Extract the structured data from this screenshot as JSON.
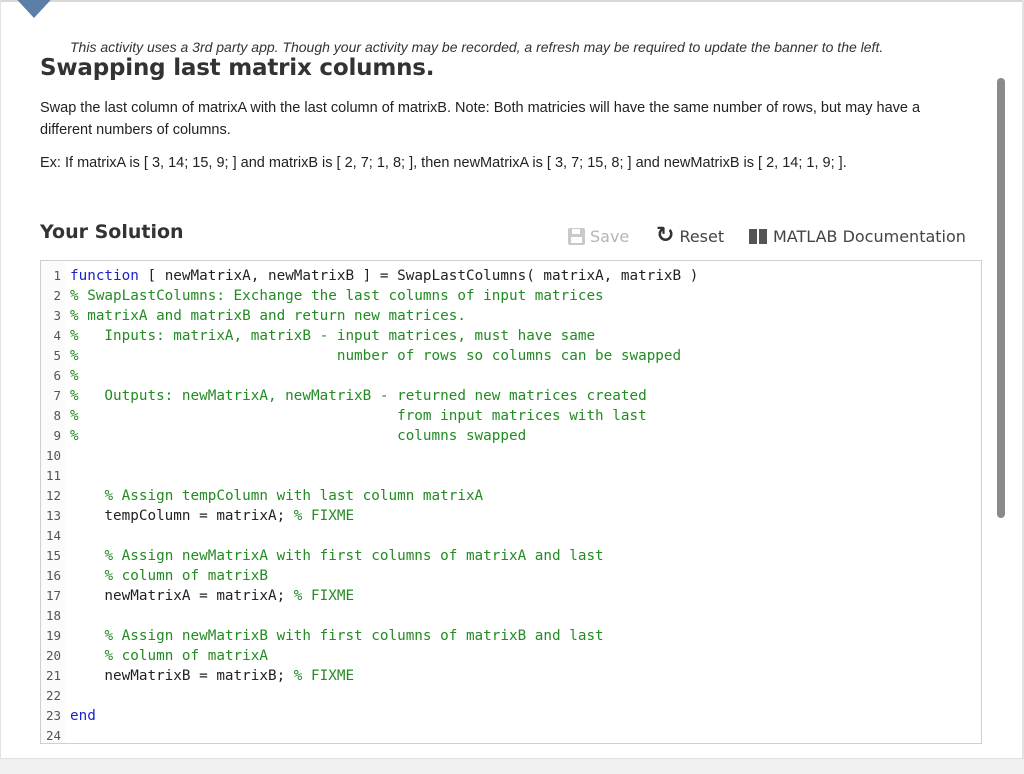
{
  "notice": "This activity uses a 3rd party app. Though your activity may be recorded, a refresh may be required to update the banner to the left.",
  "title": "Swapping last matrix columns.",
  "description": "Swap the last column of matrixA with the last column of matrixB. Note: Both matricies will have the same number of rows, but may have a different numbers of columns.",
  "example": "Ex: If matrixA is [ 3, 14; 15, 9; ] and matrixB is [ 2, 7; 1, 8; ], then newMatrixA is [ 3, 7; 15, 8; ] and newMatrixB is [ 2, 14; 1, 9; ].",
  "solution": {
    "title": "Your Solution",
    "save_label": "Save",
    "reset_label": "Reset",
    "doc_label": "MATLAB Documentation"
  },
  "icons": {
    "save": "save-icon",
    "reset": "reset-icon",
    "documentation": "book-icon"
  },
  "colors": {
    "keyword": "#1d22c8",
    "comment": "#228b22",
    "banner": "#5b7fa6"
  },
  "code_lines": [
    {
      "n": "1",
      "parts": [
        {
          "t": "function",
          "c": "kw"
        },
        {
          "t": " [ newMatrixA, newMatrixB ] = SwapLastColumns( matrixA, matrixB )",
          "c": ""
        }
      ]
    },
    {
      "n": "2",
      "parts": [
        {
          "t": "% SwapLastColumns: Exchange the last columns of input matrices",
          "c": "cm"
        }
      ]
    },
    {
      "n": "3",
      "parts": [
        {
          "t": "% matrixA and matrixB and return new matrices.",
          "c": "cm"
        }
      ]
    },
    {
      "n": "4",
      "parts": [
        {
          "t": "%   Inputs: matrixA, matrixB - input matrices, must have same",
          "c": "cm"
        }
      ]
    },
    {
      "n": "5",
      "parts": [
        {
          "t": "%                              number of rows so columns can be swapped",
          "c": "cm"
        }
      ]
    },
    {
      "n": "6",
      "parts": [
        {
          "t": "%",
          "c": "cm"
        }
      ]
    },
    {
      "n": "7",
      "parts": [
        {
          "t": "%   Outputs: newMatrixA, newMatrixB - returned new matrices created",
          "c": "cm"
        }
      ]
    },
    {
      "n": "8",
      "parts": [
        {
          "t": "%                                     from input matrices with last",
          "c": "cm"
        }
      ]
    },
    {
      "n": "9",
      "parts": [
        {
          "t": "%                                     columns swapped",
          "c": "cm"
        }
      ]
    },
    {
      "n": "10",
      "parts": []
    },
    {
      "n": "11",
      "parts": []
    },
    {
      "n": "12",
      "parts": [
        {
          "t": "    ",
          "c": ""
        },
        {
          "t": "% Assign tempColumn with last column matrixA",
          "c": "cm"
        }
      ]
    },
    {
      "n": "13",
      "parts": [
        {
          "t": "    tempColumn = matrixA; ",
          "c": ""
        },
        {
          "t": "% FIXME",
          "c": "cm"
        }
      ]
    },
    {
      "n": "14",
      "parts": []
    },
    {
      "n": "15",
      "parts": [
        {
          "t": "    ",
          "c": ""
        },
        {
          "t": "% Assign newMatrixA with first columns of matrixA and last",
          "c": "cm"
        }
      ]
    },
    {
      "n": "16",
      "parts": [
        {
          "t": "    ",
          "c": ""
        },
        {
          "t": "% column of matrixB",
          "c": "cm"
        }
      ]
    },
    {
      "n": "17",
      "parts": [
        {
          "t": "    newMatrixA = matrixA; ",
          "c": ""
        },
        {
          "t": "% FIXME",
          "c": "cm"
        }
      ]
    },
    {
      "n": "18",
      "parts": []
    },
    {
      "n": "19",
      "parts": [
        {
          "t": "    ",
          "c": ""
        },
        {
          "t": "% Assign newMatrixB with first columns of matrixB and last",
          "c": "cm"
        }
      ]
    },
    {
      "n": "20",
      "parts": [
        {
          "t": "    ",
          "c": ""
        },
        {
          "t": "% column of matrixA",
          "c": "cm"
        }
      ]
    },
    {
      "n": "21",
      "parts": [
        {
          "t": "    newMatrixB = matrixB; ",
          "c": ""
        },
        {
          "t": "% FIXME",
          "c": "cm"
        }
      ]
    },
    {
      "n": "22",
      "parts": []
    },
    {
      "n": "23",
      "parts": [
        {
          "t": "end",
          "c": "kw"
        }
      ]
    },
    {
      "n": "24",
      "parts": []
    }
  ]
}
